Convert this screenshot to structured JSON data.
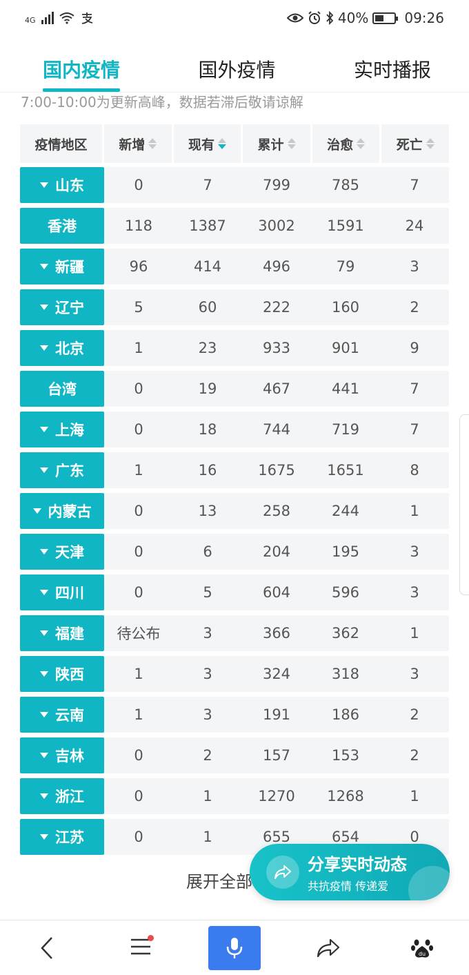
{
  "status_bar": {
    "network": "4G",
    "battery": "40%",
    "time": "09:26"
  },
  "tabs": [
    {
      "label": "国内疫情",
      "active": true
    },
    {
      "label": "国外疫情",
      "active": false
    },
    {
      "label": "实时播报",
      "active": false
    }
  ],
  "notice": "7:00-10:00为更新高峰，数据若滞后敬请谅解",
  "table": {
    "headers": [
      "疫情地区",
      "新增",
      "现有",
      "累计",
      "治愈",
      "死亡"
    ],
    "rows": [
      {
        "region": "山东",
        "expandable": true,
        "new": "0",
        "current": "7",
        "total": "799",
        "cured": "785",
        "dead": "7"
      },
      {
        "region": "香港",
        "expandable": false,
        "new": "118",
        "current": "1387",
        "total": "3002",
        "cured": "1591",
        "dead": "24"
      },
      {
        "region": "新疆",
        "expandable": true,
        "new": "96",
        "current": "414",
        "total": "496",
        "cured": "79",
        "dead": "3"
      },
      {
        "region": "辽宁",
        "expandable": true,
        "new": "5",
        "current": "60",
        "total": "222",
        "cured": "160",
        "dead": "2"
      },
      {
        "region": "北京",
        "expandable": true,
        "new": "1",
        "current": "23",
        "total": "933",
        "cured": "901",
        "dead": "9"
      },
      {
        "region": "台湾",
        "expandable": false,
        "new": "0",
        "current": "19",
        "total": "467",
        "cured": "441",
        "dead": "7"
      },
      {
        "region": "上海",
        "expandable": true,
        "new": "0",
        "current": "18",
        "total": "744",
        "cured": "719",
        "dead": "7"
      },
      {
        "region": "广东",
        "expandable": true,
        "new": "1",
        "current": "16",
        "total": "1675",
        "cured": "1651",
        "dead": "8"
      },
      {
        "region": "内蒙古",
        "expandable": true,
        "new": "0",
        "current": "13",
        "total": "258",
        "cured": "244",
        "dead": "1"
      },
      {
        "region": "天津",
        "expandable": true,
        "new": "0",
        "current": "6",
        "total": "204",
        "cured": "195",
        "dead": "3"
      },
      {
        "region": "四川",
        "expandable": true,
        "new": "0",
        "current": "5",
        "total": "604",
        "cured": "596",
        "dead": "3"
      },
      {
        "region": "福建",
        "expandable": true,
        "new": "待公布",
        "current": "3",
        "total": "366",
        "cured": "362",
        "dead": "1"
      },
      {
        "region": "陕西",
        "expandable": true,
        "new": "1",
        "current": "3",
        "total": "324",
        "cured": "318",
        "dead": "3"
      },
      {
        "region": "云南",
        "expandable": true,
        "new": "1",
        "current": "3",
        "total": "191",
        "cured": "186",
        "dead": "2"
      },
      {
        "region": "吉林",
        "expandable": true,
        "new": "0",
        "current": "2",
        "total": "157",
        "cured": "153",
        "dead": "2"
      },
      {
        "region": "浙江",
        "expandable": true,
        "new": "0",
        "current": "1",
        "total": "1270",
        "cured": "1268",
        "dead": "1"
      },
      {
        "region": "江苏",
        "expandable": true,
        "new": "0",
        "current": "1",
        "total": "655",
        "cured": "654",
        "dead": "0"
      }
    ]
  },
  "expand_label": "展开全部",
  "share": {
    "title": "分享实时动态",
    "subtitle": "共抗疫情 传递爱"
  },
  "colors": {
    "accent": "#10b6c3",
    "mic_button": "#3a7cf0",
    "notification_dot": "#e94b4b"
  },
  "bottom_nav": [
    "back-icon",
    "menu-icon",
    "mic-icon",
    "share-icon",
    "baidu-paw-icon"
  ]
}
